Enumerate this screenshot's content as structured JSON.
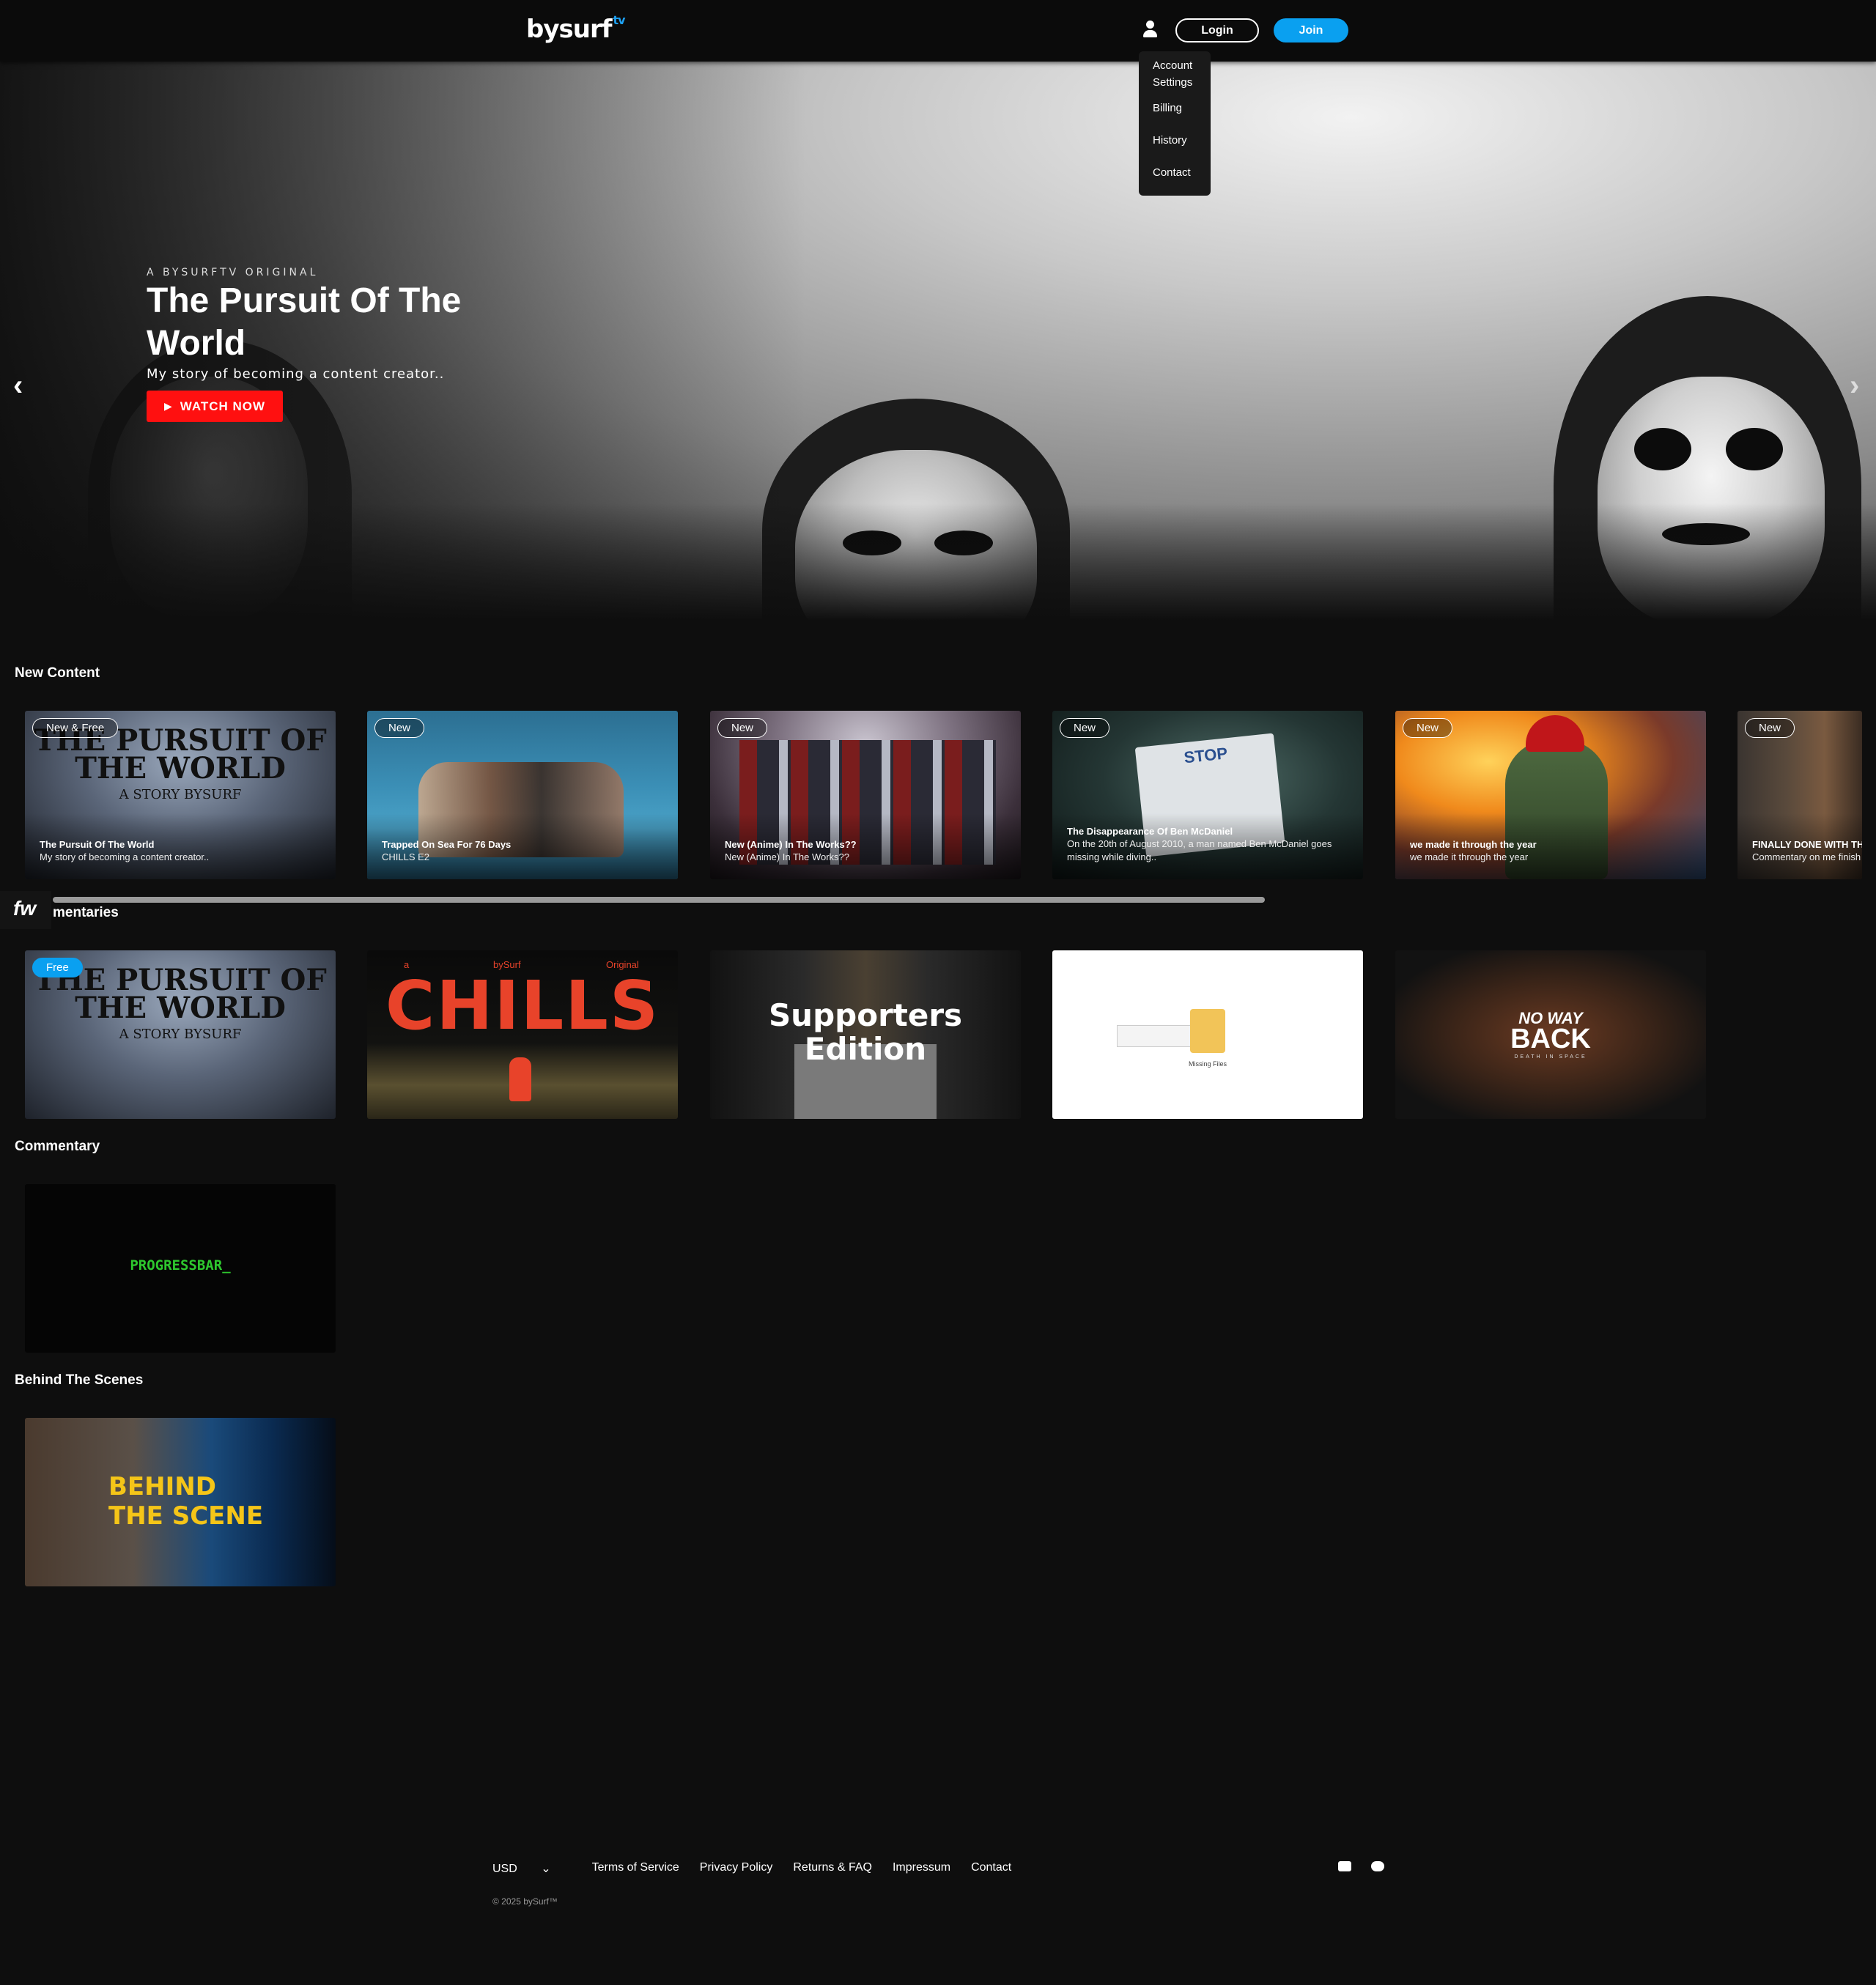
{
  "header": {
    "logo_text": "bysurf",
    "logo_suffix": "tv",
    "login_label": "Login",
    "join_label": "Join"
  },
  "account_menu": {
    "items": [
      "Account Settings",
      "Billing",
      "History",
      "Contact"
    ]
  },
  "hero": {
    "kicker": "A BYSURFTV ORIGINAL",
    "title": "The Pursuit Of The World",
    "subtitle": "My story of becoming a content creator..",
    "cta_label": "WATCH NOW",
    "prev_arrow": "‹",
    "next_arrow": "›"
  },
  "sections": {
    "new_content": {
      "title": "New Content",
      "cards": [
        {
          "badge": "New & Free",
          "title": "The Pursuit Of The World",
          "subtitle": "My story of becoming a content creator.."
        },
        {
          "badge": "New",
          "title": "Trapped On Sea For 76 Days",
          "subtitle": "CHILLS E2"
        },
        {
          "badge": "New",
          "title": "New (Anime) In The Works??",
          "subtitle": "New (Anime) In The Works??"
        },
        {
          "badge": "New",
          "title": "The Disappearance Of Ben McDaniel",
          "subtitle": "On the 20th of August 2010, a man named Ben McDaniel goes",
          "subtitle2": "missing while diving.."
        },
        {
          "badge": "New",
          "title": "we made it through the year",
          "subtitle": "we made it through the year"
        },
        {
          "badge": "New",
          "title": "FINALLY DONE WITH THE",
          "subtitle": "Commentary on me finish"
        }
      ]
    },
    "documentaries": {
      "title_fragment": "mentaries",
      "fw_logo": "fw",
      "cards": [
        {
          "badge": "Free",
          "poster_line1": "THE PURSUIT OF",
          "poster_line2": "THE WORLD",
          "poster_line3": "A STORY BYSURF"
        },
        {
          "poster_top_left": "a",
          "poster_top_mid": "bySurf",
          "poster_top_right": "Original",
          "poster_title": "CHILLS"
        },
        {
          "poster_title": "Supporters Edition"
        },
        {
          "poster_caption": "Missing Files"
        },
        {
          "poster_title_small": "NO WAY",
          "poster_title": "BACK",
          "poster_sub": "DEATH IN SPACE"
        }
      ]
    },
    "commentary": {
      "title": "Commentary",
      "cards": [
        {
          "poster_title": "PROGRESSBAR_"
        }
      ]
    },
    "behind_the_scenes": {
      "title": "Behind The Scenes",
      "cards": [
        {
          "poster_line1": "BEHIND",
          "poster_line2": "THE SCENE"
        }
      ]
    }
  },
  "footer": {
    "currency": "USD",
    "links": [
      "Terms of Service",
      "Privacy Policy",
      "Returns & FAQ",
      "Impressum",
      "Contact"
    ],
    "copyright": "© 2025 bySurf™",
    "social_icons": [
      "youtube-icon",
      "discord-icon"
    ]
  },
  "colors": {
    "accent_blue": "#0aa0f0",
    "cta_red": "#ff1010",
    "background": "#0e0e0e"
  }
}
